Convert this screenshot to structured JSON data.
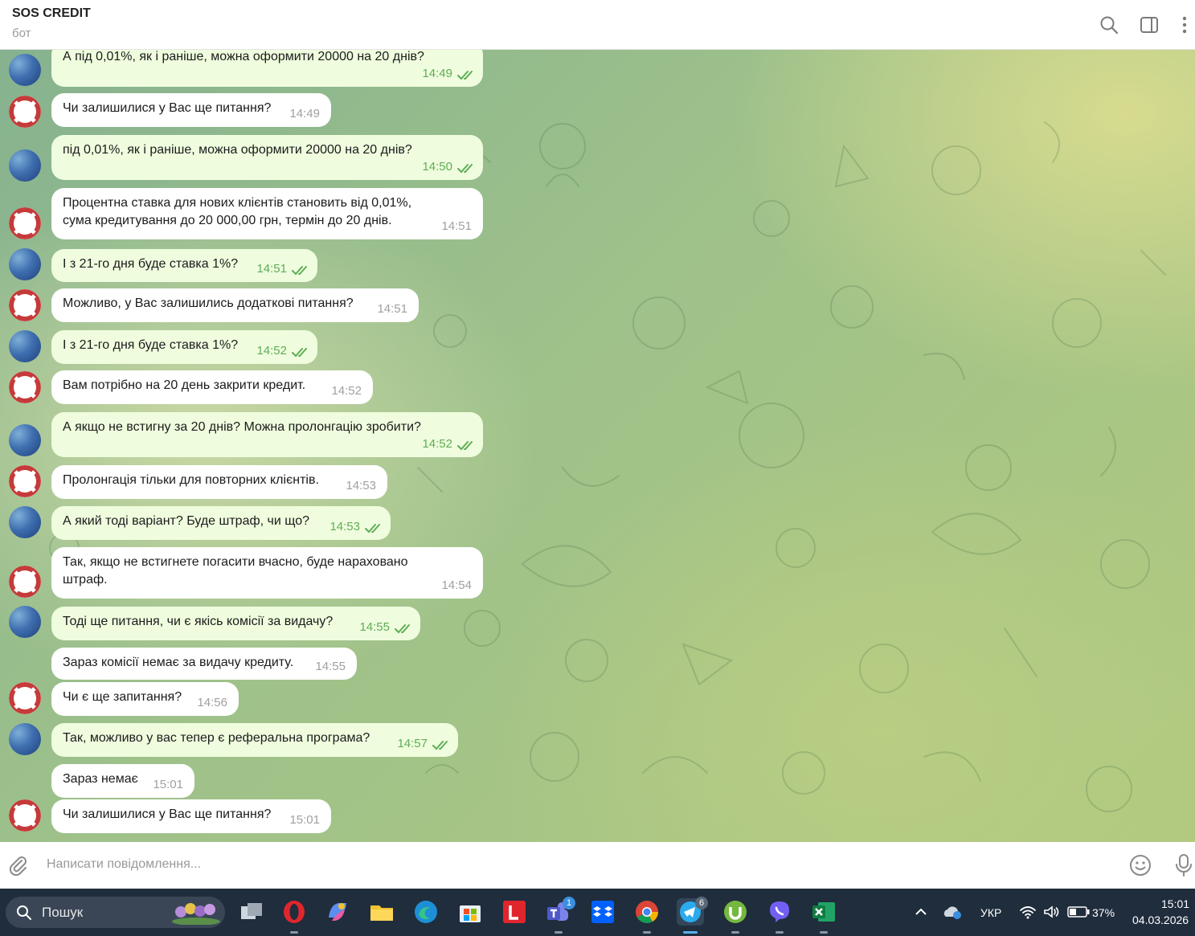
{
  "header": {
    "title": "SOS CREDIT",
    "subtitle": "бот",
    "icons": [
      "search-icon",
      "sidebar-toggle-icon",
      "more-icon"
    ]
  },
  "messages": [
    {
      "dir": "out",
      "text": "А під 0,01%, як і раніше, можна оформити 20000 на 20 днів?",
      "time": "14:49"
    },
    {
      "dir": "in",
      "text": "Чи залишилися у Вас ще питання?",
      "time": "14:49"
    },
    {
      "dir": "out",
      "text": "під 0,01%, як і раніше, можна оформити 20000 на 20 днів?",
      "time": "14:50"
    },
    {
      "dir": "in",
      "text": "Процентна ставка для нових клієнтів становить від 0,01%, сума кредитування до 20 000,00 грн, термін до 20 днів.",
      "time": "14:51"
    },
    {
      "dir": "out",
      "text": "І з 21-го дня буде ставка 1%?",
      "time": "14:51"
    },
    {
      "dir": "in",
      "text": "Можливо, у Вас залишились додаткові питання?",
      "time": "14:51"
    },
    {
      "dir": "out",
      "text": "І з 21-го дня буде ставка 1%?",
      "time": "14:52"
    },
    {
      "dir": "in",
      "text": "Вам потрібно на 20 день закрити кредит.",
      "time": "14:52"
    },
    {
      "dir": "out",
      "text": "А якщо не встигну за 20 днів? Можна пролонгацію зробити?",
      "time": "14:52"
    },
    {
      "dir": "in",
      "text": "Пролонгація тільки для повторних клієнтів.",
      "time": "14:53"
    },
    {
      "dir": "out",
      "text": "А який тоді варіант? Буде штраф, чи що?",
      "time": "14:53"
    },
    {
      "dir": "in",
      "text": "Так, якщо не встигнете погасити вчасно, буде нараховано штраф.",
      "time": "14:54"
    },
    {
      "dir": "out",
      "text": "Тоді ще питання, чи є якісь комісії за видачу?",
      "time": "14:55"
    },
    {
      "dir": "in",
      "text": "Зараз комісії немає за видачу кредиту.",
      "time": "14:55"
    },
    {
      "dir": "in",
      "text": "Чи є ще запитання?",
      "time": "14:56"
    },
    {
      "dir": "out",
      "text": "Так, можливо у вас тепер є реферальна програма?",
      "time": "14:57"
    },
    {
      "dir": "in",
      "text": "Зараз немає",
      "time": "15:01"
    },
    {
      "dir": "in",
      "text": "Чи залишилися у Вас ще питання?",
      "time": "15:01"
    }
  ],
  "input": {
    "placeholder": "Написати повідомлення..."
  },
  "taskbar": {
    "search_label": "Пошук",
    "teams_badge": "1",
    "telegram_badge": "6",
    "language": "УКР",
    "battery": "37%",
    "time": "15:01",
    "date": "04.03.2026"
  },
  "colors": {
    "outgoing_bubble": "#effdde",
    "incoming_bubble": "#ffffff",
    "outgoing_time": "#5fad56",
    "taskbar": "#1f2d3d"
  }
}
